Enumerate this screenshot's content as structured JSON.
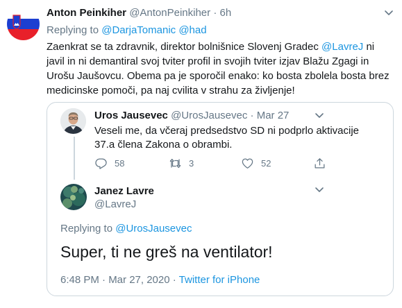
{
  "tweet": {
    "author_name": "Anton Peinkiher",
    "author_handle": "@AntonPeinkiher",
    "separator": "·",
    "time": "6h",
    "replying_prefix": "Replying to",
    "replying_handles": [
      "@DarjaTomanic",
      "@had"
    ],
    "text_part1": "Zaenkrat se ta zdravnik, direktor bolnišnice Slovenj Gradec ",
    "text_mention": "@LavreJ",
    "text_part2": " ni javil in ni demantiral svoj tviter profil in svojih tviter izjav Blažu Zgagi in Urošu Jaušovcu. Obema pa je sporočil enako: ko bosta zbolela bosta brez medicinske pomoči, pa naj cvilita v strahu za življenje!",
    "avatar_icon": "slovenia-flag-icon"
  },
  "quoted_thread": {
    "first": {
      "author_name": "Uros Jausevec",
      "author_handle": "@UrosJausevec",
      "separator": "·",
      "time": "Mar 27",
      "text": "Veseli me, da včeraj predsedstvo SD ni podprlo aktivacije 37.a člena Zakona o obrambi.",
      "replies": "58",
      "retweets": "3",
      "likes": "52"
    },
    "second": {
      "author_name": "Janez Lavre",
      "author_handle": "@LavreJ",
      "replying_prefix": "Replying to",
      "replying_handle": "@UrosJausevec",
      "text": "Super, ti ne greš na ventilator!",
      "timestamp": "6:48 PM · Mar 27, 2020",
      "footer_separator": "·",
      "source": "Twitter for iPhone"
    }
  },
  "colors": {
    "link": "#1b95e0",
    "muted": "#657786",
    "border": "#ccd6dd",
    "text": "#14171a"
  }
}
